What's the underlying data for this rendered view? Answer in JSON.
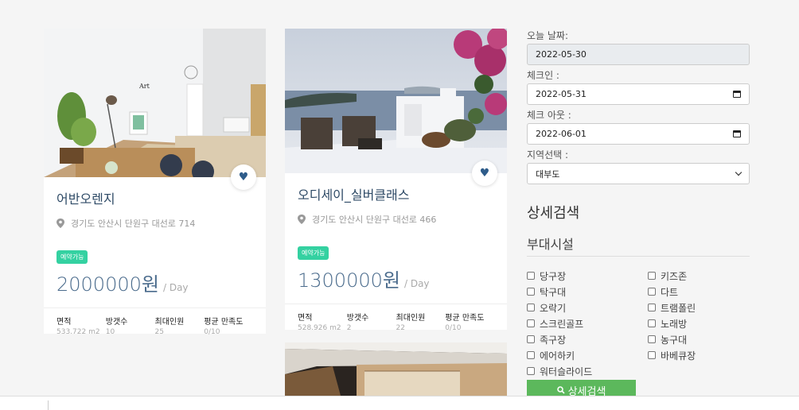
{
  "cards": [
    {
      "title": "어반오렌지",
      "address": "경기도 안산시 단원구 대선로 714",
      "badge": "예약가능",
      "price": "2000000원",
      "per_day": "/ Day",
      "stats": [
        {
          "label": "면적",
          "value": "533.722 m2"
        },
        {
          "label": "방갯수",
          "value": "10"
        },
        {
          "label": "최대인원",
          "value": "25"
        },
        {
          "label": "평균 만족도",
          "value": "0/10"
        }
      ]
    },
    {
      "title": "오디세이_실버클래스",
      "address": "경기도 안산시 단원구 대선로 466",
      "badge": "예약가능",
      "price": "1300000원",
      "per_day": "/ Day",
      "stats": [
        {
          "label": "면적",
          "value": "528.926 m2"
        },
        {
          "label": "방갯수",
          "value": "2"
        },
        {
          "label": "최대인원",
          "value": "22"
        },
        {
          "label": "평균 만족도",
          "value": "0/10"
        }
      ]
    }
  ],
  "sidebar": {
    "today_label": "오늘 날짜:",
    "today_value": "2022-05-30",
    "checkin_label": "체크인 :",
    "checkin_value": "2022-05-31",
    "checkout_label": "체크 아웃 :",
    "checkout_value": "2022-06-01",
    "region_label": "지역선택 :",
    "region_value": "대부도",
    "detail_heading": "상세검색",
    "facilities_heading": "부대시설",
    "facilities": [
      "당구장",
      "키즈존",
      "탁구대",
      "다트",
      "오락기",
      "트램폴린",
      "스크린골프",
      "노래방",
      "족구장",
      "농구대",
      "에어하키",
      "바베큐장",
      "워터슬라이드"
    ],
    "search_button": "상세검색"
  },
  "icons": {
    "favorite": "heart-icon",
    "location": "map-pin-icon",
    "calendar": "calendar-icon",
    "dropdown": "chevron-down-icon",
    "search": "search-icon"
  },
  "colors": {
    "badge": "#34d1a1",
    "search_button": "#5cb85c",
    "price": "#4a6b8c",
    "heart": "#2e5c8a"
  }
}
